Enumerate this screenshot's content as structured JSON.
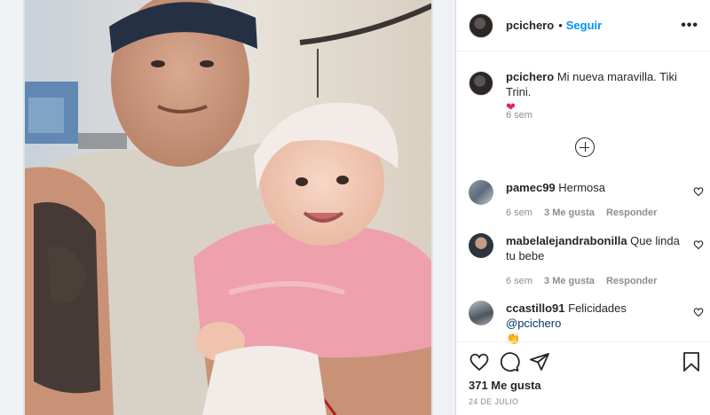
{
  "post": {
    "author": "pcichero",
    "follow_label": "Seguir",
    "more_label": "•••",
    "caption_author": "pcichero",
    "caption_text": "Mi nueva maravilla. Tiki Trini.",
    "caption_emoji": "❤",
    "caption_time": "6 sem",
    "likes": "371 Me gusta",
    "date": "24 DE JULIO"
  },
  "comments": [
    {
      "user": "pamec99",
      "text": "Hermosa",
      "time": "6 sem",
      "likes": "3 Me gusta",
      "reply": "Responder"
    },
    {
      "user": "mabelalejandrabonilla",
      "text": "Que linda tu bebe",
      "time": "6 sem",
      "likes": "3 Me gusta",
      "reply": "Responder"
    },
    {
      "user": "ccastillo91",
      "text": "Felicidades",
      "mention": "@pcichero",
      "emoji": "👏"
    }
  ],
  "icons": {
    "like": "heart-icon",
    "comment": "comment-bubble-icon",
    "share": "paper-plane-icon",
    "save": "bookmark-icon",
    "load_more": "plus-circle-icon",
    "more": "ellipsis-icon"
  },
  "colors": {
    "link": "#0095f6",
    "text": "#262626",
    "muted": "#8e8e8e",
    "heart": "#e0245e"
  }
}
